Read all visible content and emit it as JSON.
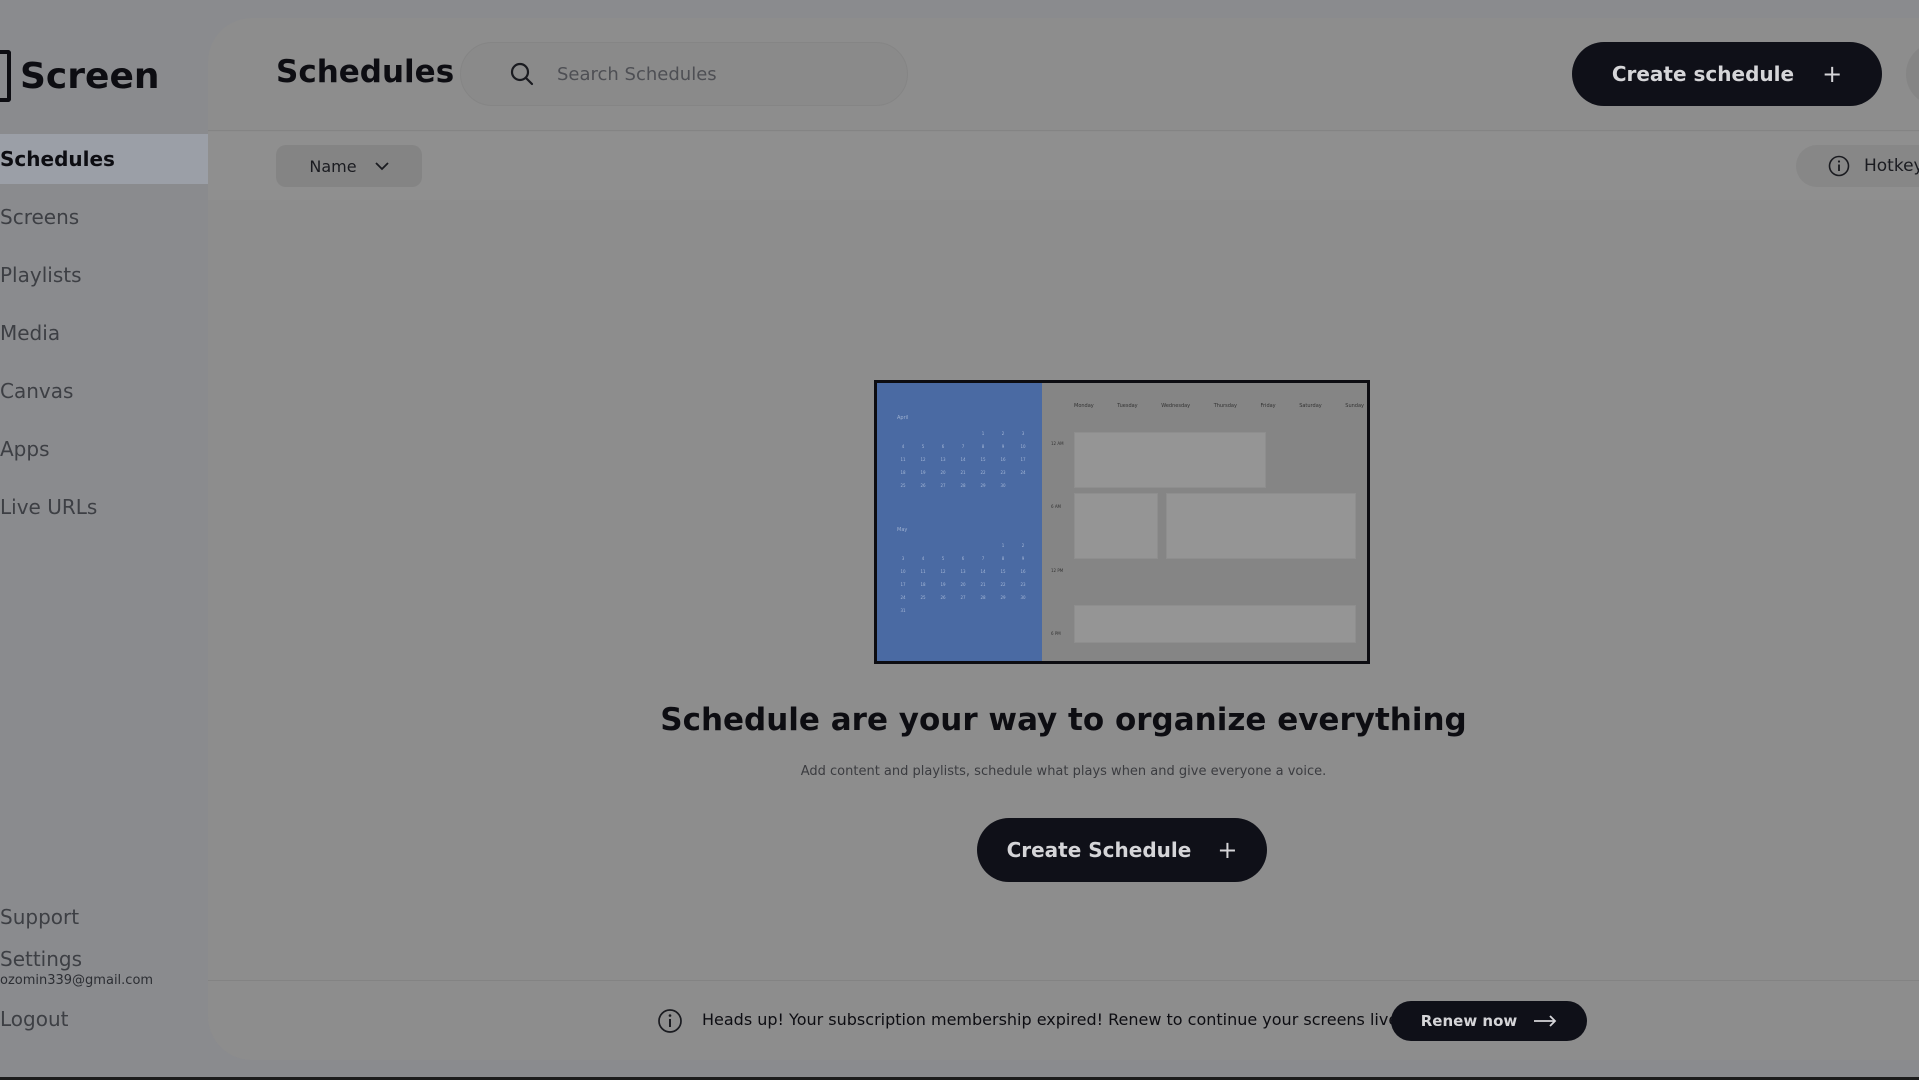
{
  "brand": {
    "name": "Screen"
  },
  "sidebar": {
    "items": [
      {
        "label": "Schedules",
        "active": true
      },
      {
        "label": "Screens"
      },
      {
        "label": "Playlists"
      },
      {
        "label": "Media"
      },
      {
        "label": "Canvas"
      },
      {
        "label": "Apps"
      },
      {
        "label": "Live URLs"
      }
    ],
    "support": "Support",
    "settings": "Settings",
    "email": "ozomin339@gmail.com",
    "logout": "Logout"
  },
  "header": {
    "title": "Schedules",
    "search_placeholder": "Search Schedules",
    "create_label": "Create schedule",
    "create_icon": "+"
  },
  "filters": {
    "sort_label": "Name",
    "hotkeys_label": "Hotkeys"
  },
  "illustration": {
    "months": [
      "April",
      "May"
    ],
    "april_days": [
      "",
      "",
      "",
      "",
      "1",
      "2",
      "3",
      "4",
      "5",
      "6",
      "7",
      "8",
      "9",
      "10",
      "11",
      "12",
      "13",
      "14",
      "15",
      "16",
      "17",
      "18",
      "19",
      "20",
      "21",
      "22",
      "23",
      "24",
      "25",
      "26",
      "27",
      "28",
      "29",
      "30"
    ],
    "may_days": [
      "",
      "",
      "",
      "",
      "",
      "1",
      "2",
      "3",
      "4",
      "5",
      "6",
      "7",
      "8",
      "9",
      "10",
      "11",
      "12",
      "13",
      "14",
      "15",
      "16",
      "17",
      "18",
      "19",
      "20",
      "21",
      "22",
      "23",
      "24",
      "25",
      "26",
      "27",
      "28",
      "29",
      "30",
      "31"
    ],
    "weekdays": [
      "Monday",
      "Tuesday",
      "Wednesday",
      "Thursday",
      "Friday",
      "Saturday",
      "Sunday"
    ],
    "times": [
      "12 AM",
      "6 AM",
      "12 PM",
      "6 PM"
    ]
  },
  "empty_state": {
    "title": "Schedule are your way to organize everything",
    "subtitle": "Add content and playlists, schedule what plays when and give everyone a voice.",
    "cta_label": "Create Schedule",
    "cta_icon": "+"
  },
  "banner": {
    "message": "Heads up! Your subscription membership expired! Renew to continue your screens live.",
    "renew_label": "Renew now"
  },
  "colors": {
    "accent": "#0f1018",
    "calendar_blue": "#4a6aa3",
    "active_nav": "#9b9fa7"
  },
  "icons": {
    "search": "search-icon",
    "sort": "chevron-down-icon",
    "hotkeys": "info-icon",
    "banner": "info-icon",
    "renew": "arrow-right-icon",
    "create": "plus-icon"
  }
}
